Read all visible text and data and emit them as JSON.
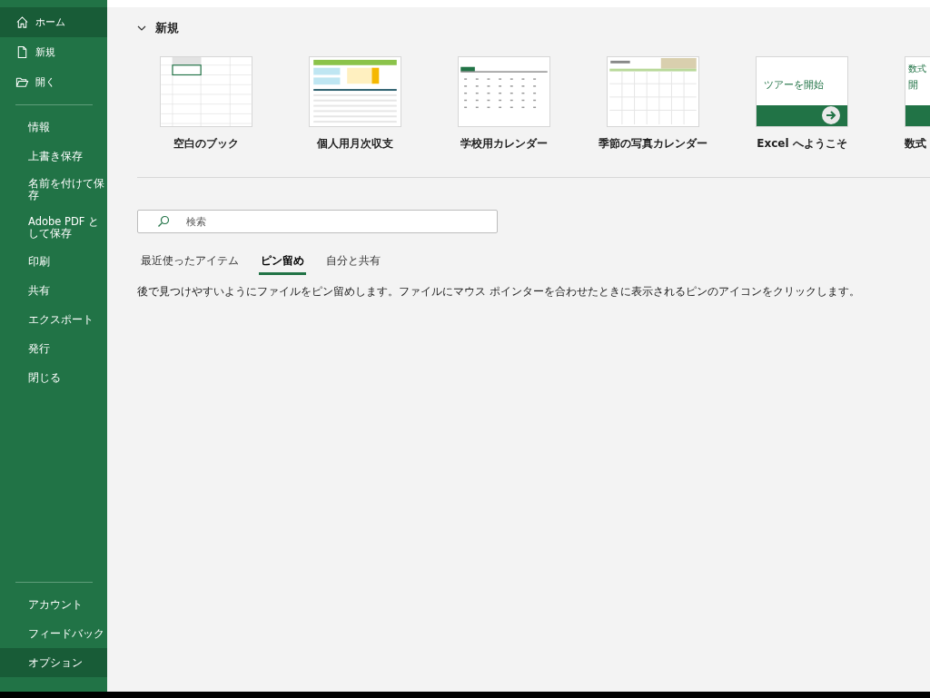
{
  "sidebar": {
    "top_items": [
      {
        "label": "ホーム",
        "selected": true
      },
      {
        "label": "新規",
        "selected": false
      },
      {
        "label": "開く",
        "selected": false
      }
    ],
    "items": [
      {
        "label": "情報",
        "hovered": false
      },
      {
        "label": "上書き保存",
        "hovered": false
      },
      {
        "label": "名前を付けて保存",
        "hovered": false
      },
      {
        "label": "Adobe PDF として保存",
        "hovered": false
      },
      {
        "label": "印刷",
        "hovered": false
      },
      {
        "label": "共有",
        "hovered": false
      },
      {
        "label": "エクスポート",
        "hovered": false
      },
      {
        "label": "発行",
        "hovered": false
      },
      {
        "label": "閉じる",
        "hovered": false
      }
    ],
    "bottom_items": [
      {
        "label": "アカウント",
        "hovered": false
      },
      {
        "label": "フィードバック",
        "hovered": false
      },
      {
        "label": "オプション",
        "hovered": true
      }
    ]
  },
  "new_section": {
    "title": "新規",
    "expanded": true,
    "templates": [
      {
        "kind": "blank",
        "label": "空白のブック"
      },
      {
        "kind": "budget",
        "label": "個人用月次収支"
      },
      {
        "kind": "calendar",
        "label": "学校用カレンダー"
      },
      {
        "kind": "photo-calendar",
        "label": "季節の写真カレンダー"
      },
      {
        "kind": "tour",
        "label": "Excel へようこそ",
        "thumb_text": "ツアーを開始"
      },
      {
        "kind": "tour-cut",
        "label": "数式",
        "thumb_caption": "数式",
        "thumb_text": "開"
      }
    ]
  },
  "search": {
    "placeholder": "検索"
  },
  "tabs": [
    {
      "label": "最近使ったアイテム",
      "selected": false
    },
    {
      "label": "ピン留め",
      "selected": true
    },
    {
      "label": "自分と共有",
      "selected": false
    }
  ],
  "description": "後で見つけやすいようにファイルをピン留めします。ファイルにマウス ポインターを合わせたときに表示されるピンのアイコンをクリックします。"
}
